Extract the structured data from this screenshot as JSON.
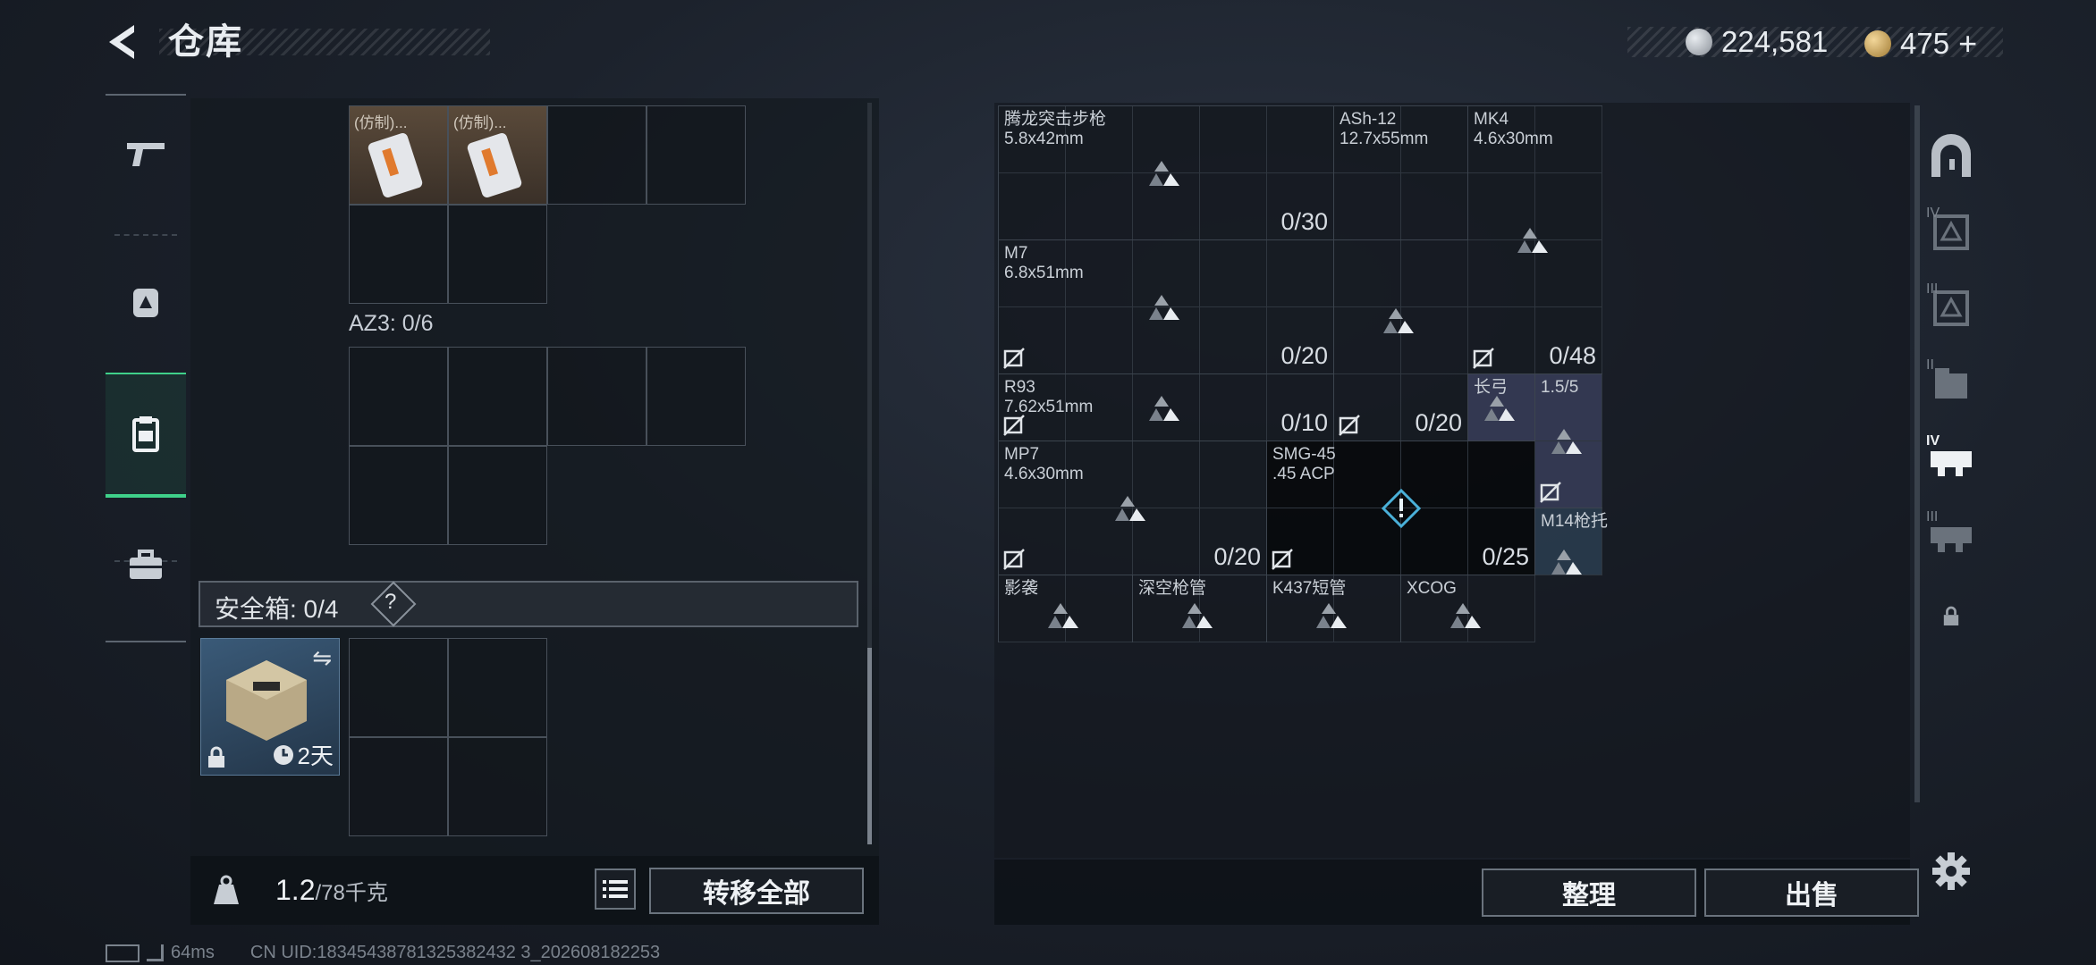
{
  "header": {
    "title": "仓库",
    "currency1": "224,581",
    "currency2": "475",
    "currency2_plus": "+"
  },
  "left": {
    "items": [
      {
        "label": "(仿制)..."
      },
      {
        "label": "(仿制)..."
      }
    ],
    "az3_label": "AZ3: 0/6",
    "safebox_label": "安全箱: 0/4",
    "safebox_help": "?",
    "safebox_timer": "2天",
    "weight_value": "1.2",
    "weight_max": "/78千克",
    "transfer_all": "转移全部"
  },
  "right": {
    "slots": [
      {
        "name": "腾龙突击步枪\n5.8x42mm",
        "count": "0/30"
      },
      {
        "name": "ASh-12\n12.7x55mm",
        "count": ""
      },
      {
        "name": "MK4\n4.6x30mm",
        "count": "0/48"
      },
      {
        "name": "M7\n6.8x51mm",
        "count": "0/20"
      },
      {
        "name": "R93\n7.62x51mm",
        "count": "0/10"
      },
      {
        "name": "",
        "count": "0/20"
      },
      {
        "name": "长弓",
        "count": ""
      },
      {
        "name": "1.5/5",
        "count": ""
      },
      {
        "name": "MP7\n4.6x30mm",
        "count": "0/20"
      },
      {
        "name": "SMG-45\n.45 ACP",
        "count": "0/25"
      },
      {
        "name": "M14枪托",
        "count": ""
      },
      {
        "name": "影袭",
        "count": ""
      },
      {
        "name": "深空枪管",
        "count": ""
      },
      {
        "name": "K437短管",
        "count": ""
      },
      {
        "name": "XCOG",
        "count": ""
      }
    ],
    "sort_button": "整理",
    "sell_button": "出售"
  },
  "right_tabs": [
    "IV",
    "III",
    "II",
    "IV",
    "III"
  ],
  "footer": {
    "ping": "64ms",
    "uid": "CN UID:18345438781325382432 3_202608182253"
  },
  "colors": {
    "accent_green": "#3fd18a",
    "gold": "#c9a55b",
    "silver": "#b7bcc4"
  }
}
